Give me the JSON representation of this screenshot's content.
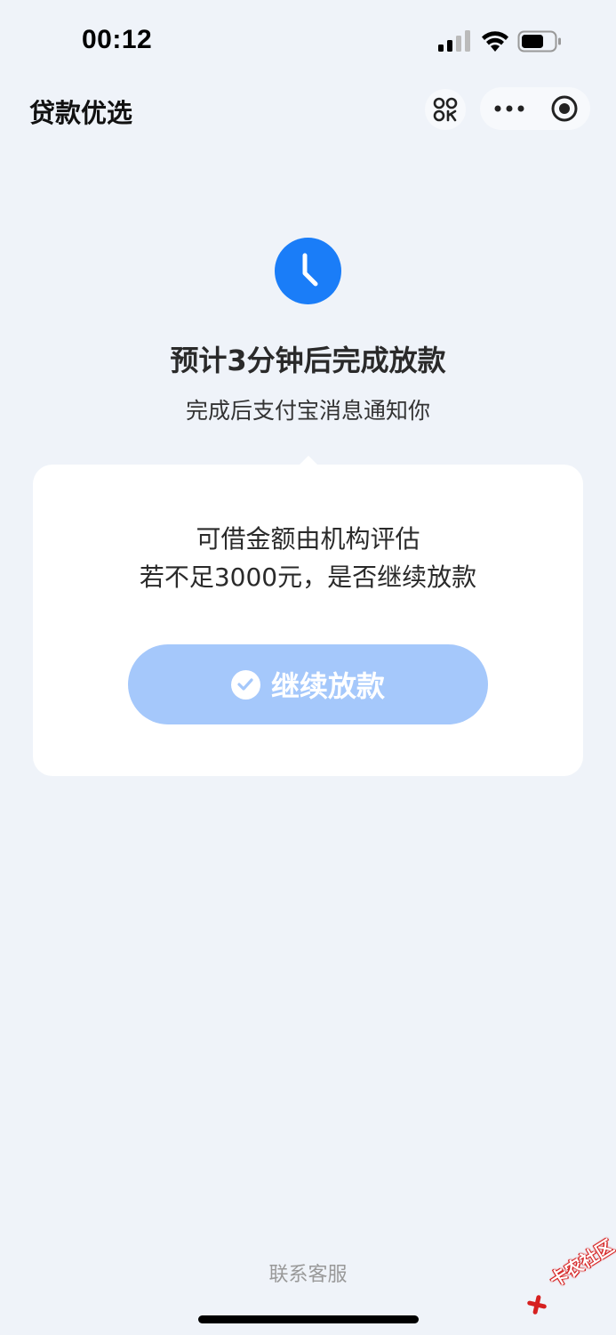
{
  "status_bar": {
    "time": "00:12"
  },
  "nav": {
    "title": "贷款优选"
  },
  "status_section": {
    "headline": "预计3分钟后完成放款",
    "subline": "完成后支付宝消息通知你"
  },
  "card": {
    "line1": "可借金额由机构评估",
    "line2": "若不足3000元，是否继续放款",
    "continue_label": "继续放款"
  },
  "footer": {
    "contact_label": "联系客服"
  },
  "watermark": {
    "text": "卡农社区"
  },
  "colors": {
    "background": "#eff3f9",
    "accent_blue": "#1a7df8",
    "button_disabled_blue": "#a5c8fb",
    "card": "#ffffff"
  },
  "icons": {
    "clock": "clock-icon",
    "scan": "scan-icon",
    "more": "more-icon",
    "close": "close-target-icon",
    "check": "check-circle-icon"
  }
}
